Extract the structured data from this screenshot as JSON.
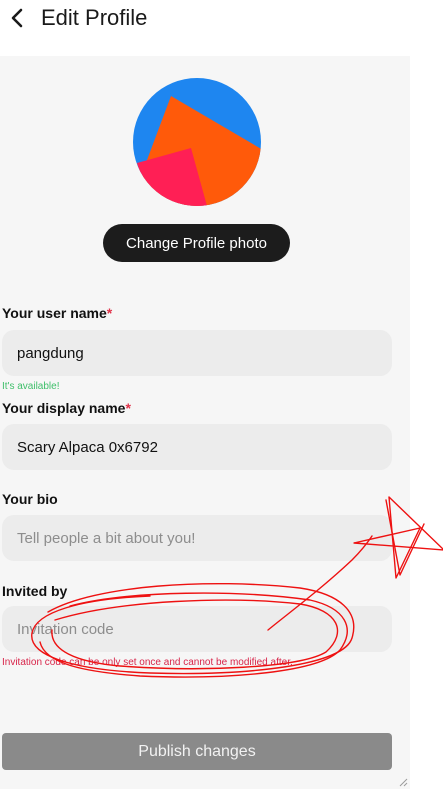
{
  "header": {
    "title": "Edit Profile",
    "back_icon": "chevron-left-icon"
  },
  "avatar": {
    "colors": [
      "#1e86f0",
      "#ff5a0a",
      "#ff1f55"
    ]
  },
  "change_photo_label": "Change Profile photo",
  "username": {
    "label": "Your user name",
    "required_mark": "*",
    "value": "pangdung",
    "availability": "It's available!"
  },
  "display_name": {
    "label": "Your display name",
    "required_mark": "*",
    "value": "Scary Alpaca 0x6792"
  },
  "bio": {
    "label": "Your bio",
    "placeholder": "Tell people a bit about you!"
  },
  "invited_by": {
    "label": "Invited by",
    "placeholder": "Invitation code",
    "note": "Invitation code can be only set once and cannot be modified after."
  },
  "publish_label": "Publish changes",
  "colors": {
    "accent_dark": "#1c1c1c",
    "required": "#e0334a",
    "success": "#3fbf6a",
    "warning": "#d8254a",
    "annotation": "#ee1111"
  }
}
